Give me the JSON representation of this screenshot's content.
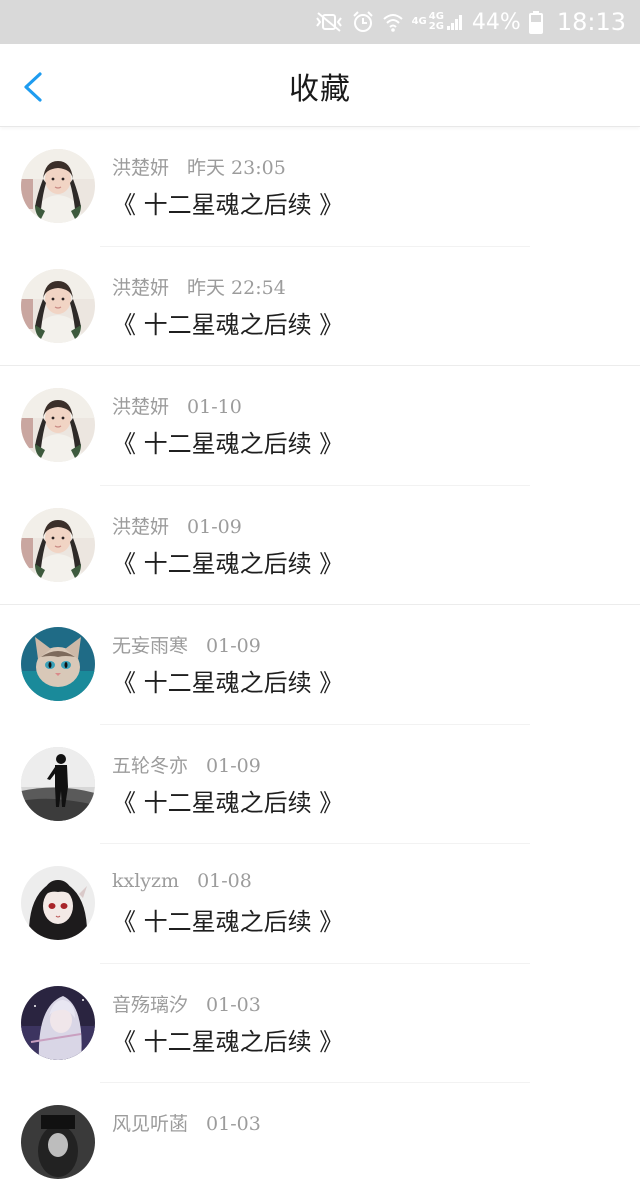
{
  "status_bar": {
    "network_text": [
      "4G",
      "4G",
      "2G"
    ],
    "battery_percent": "44%",
    "time": "18:13",
    "icons": [
      "mute-vibrate-icon",
      "alarm-icon",
      "wifi-icon",
      "signal-icon",
      "battery-icon"
    ]
  },
  "header": {
    "title": "收藏",
    "back_icon": "chevron-left-icon",
    "accent_color": "#1e9cf0"
  },
  "items": [
    {
      "author": "洪楚妍",
      "time": "昨天 23:05",
      "title": "《 十二星魂之后续 》",
      "avatar": "girl-photo"
    },
    {
      "author": "洪楚妍",
      "time": "昨天 22:54",
      "title": "《 十二星魂之后续 》",
      "avatar": "girl-photo"
    },
    {
      "author": "洪楚妍",
      "time": "01-10",
      "title": "《 十二星魂之后续 》",
      "avatar": "girl-photo"
    },
    {
      "author": "洪楚妍",
      "time": "01-09",
      "title": "《 十二星魂之后续 》",
      "avatar": "girl-photo"
    },
    {
      "author": "无妄雨寒",
      "time": "01-09",
      "title": "《 十二星魂之后续 》",
      "avatar": "cat-photo"
    },
    {
      "author": "五轮冬亦",
      "time": "01-09",
      "title": "《 十二星魂之后续 》",
      "avatar": "silhouette-photo"
    },
    {
      "author": "kxlyzm",
      "time": "01-08",
      "title": "《 十二星魂之后续 》",
      "avatar": "anime-girl"
    },
    {
      "author": "音殇璃汐",
      "time": "01-03",
      "title": "《 十二星魂之后续 》",
      "avatar": "anime-white-hair"
    },
    {
      "author": "风见听菡",
      "time": "01-03",
      "title": "",
      "avatar": "dark-photo"
    }
  ]
}
